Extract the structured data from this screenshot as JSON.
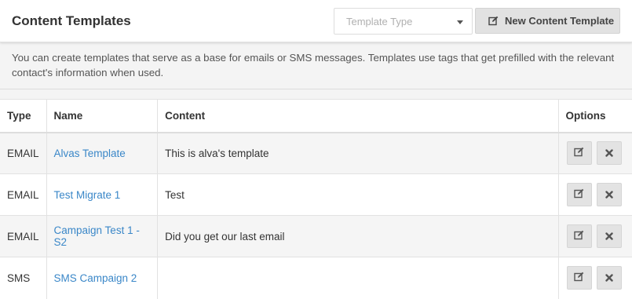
{
  "header": {
    "title": "Content Templates",
    "type_select": {
      "placeholder": "Template Type",
      "caret_icon": "caret-down-icon"
    },
    "new_button": {
      "label": "New Content Template",
      "icon": "edit-icon"
    }
  },
  "intro": "You can create templates that serve as a base for emails or SMS messages. Templates use tags that get prefilled with the relevant contact's information when used.",
  "table": {
    "columns": [
      "Type",
      "Name",
      "Content",
      "Options"
    ],
    "rows": [
      {
        "type": "EMAIL",
        "name": "Alvas Template",
        "content": "This is alva's template"
      },
      {
        "type": "EMAIL",
        "name": "Test Migrate 1",
        "content": "Test"
      },
      {
        "type": "EMAIL",
        "name": "Campaign Test 1 - S2",
        "content": "Did you get our last email"
      },
      {
        "type": "SMS",
        "name": "SMS Campaign 2",
        "content": ""
      }
    ],
    "option_icons": [
      "edit-icon",
      "delete-icon"
    ]
  },
  "colors": {
    "link": "#3a87c8",
    "button_bg": "#e2e2e2",
    "page_bg": "#f4f4f4"
  }
}
